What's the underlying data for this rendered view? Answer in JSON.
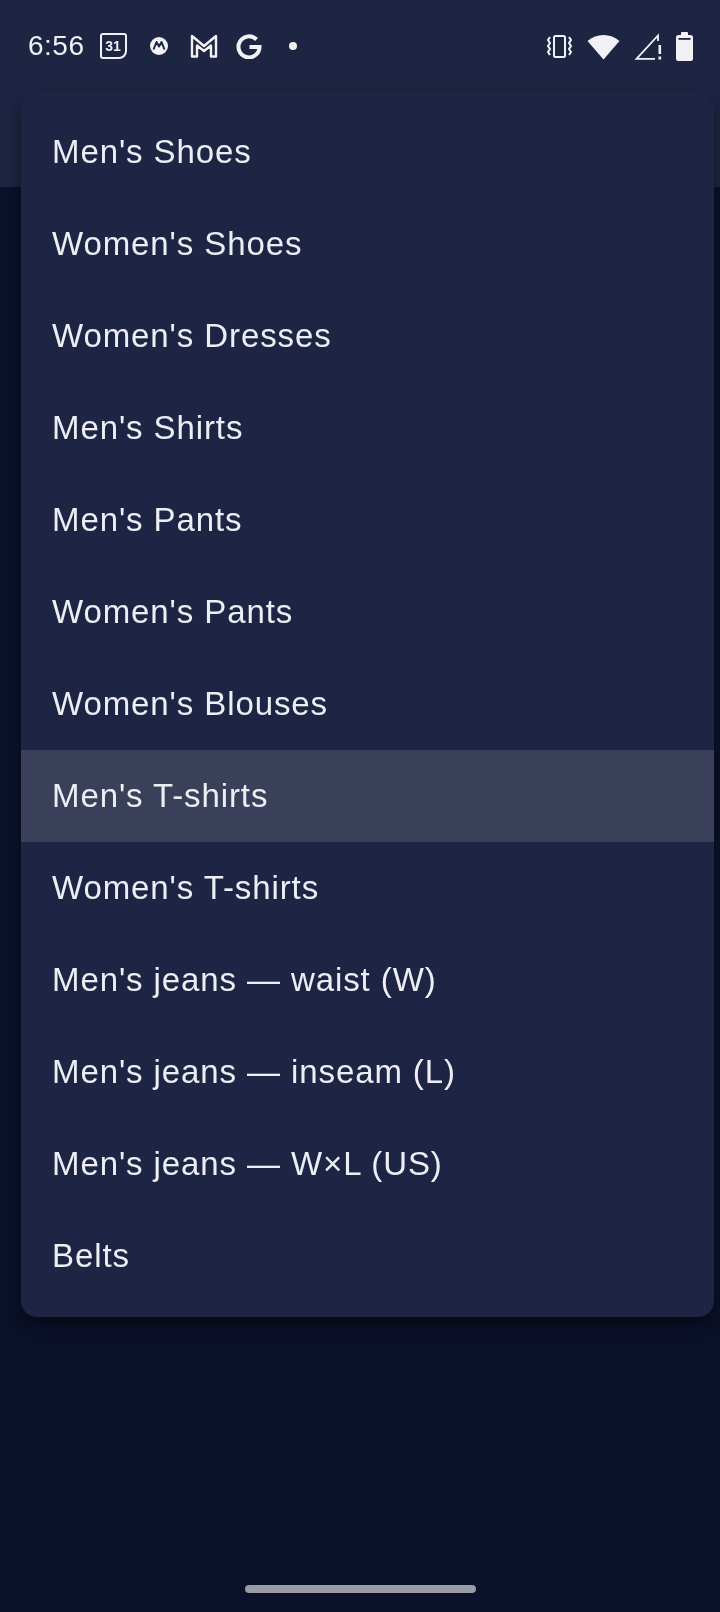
{
  "status_bar": {
    "time": "6:56",
    "calendar_day": "31"
  },
  "menu": {
    "items": [
      {
        "label": "Men's Shoes",
        "selected": false
      },
      {
        "label": "Women's Shoes",
        "selected": false
      },
      {
        "label": "Women's Dresses",
        "selected": false
      },
      {
        "label": "Men's Shirts",
        "selected": false
      },
      {
        "label": "Men's Pants",
        "selected": false
      },
      {
        "label": "Women's Pants",
        "selected": false
      },
      {
        "label": "Women's Blouses",
        "selected": false
      },
      {
        "label": "Men's T-shirts",
        "selected": true
      },
      {
        "label": "Women's T-shirts",
        "selected": false
      },
      {
        "label": "Men's jeans — waist (W)",
        "selected": false
      },
      {
        "label": "Men's jeans — inseam (L)",
        "selected": false
      },
      {
        "label": "Men's jeans — W×L (US)",
        "selected": false
      },
      {
        "label": "Belts",
        "selected": false
      }
    ]
  }
}
